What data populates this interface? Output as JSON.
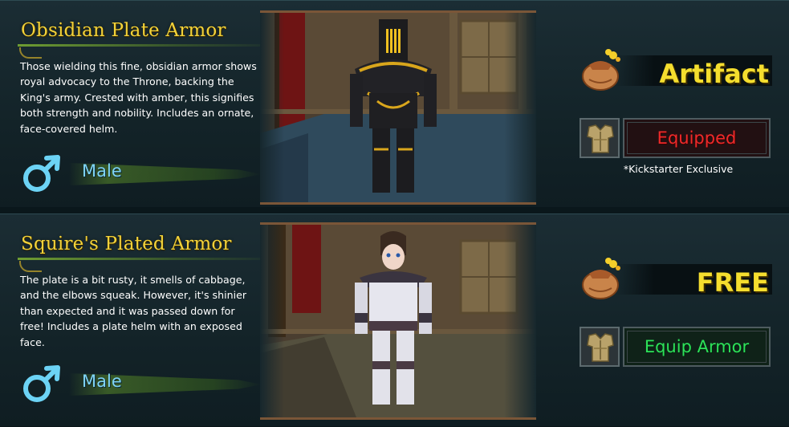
{
  "colors": {
    "title": "#f2d23a",
    "gender_label": "#7fd4f4",
    "price": "#f5de2e",
    "equipped": "#ee2a2a",
    "equip": "#2ee05a"
  },
  "items": [
    {
      "title": "Obsidian Plate Armor",
      "description": "Those wielding this fine, obsidian armor shows royal advocacy to the Throne, backing the King's army. Crested with amber, this signifies both strength and nobility. Includes an ornate, face-covered helm.",
      "gender": "Male",
      "gender_icon": "male-symbol-icon",
      "price": "Artifact",
      "price_icon": "coin-bag-icon",
      "action": "Equipped",
      "action_state": "equipped",
      "note": "*Kickstarter Exclusive"
    },
    {
      "title": "Squire's Plated Armor",
      "description": "The plate is a bit rusty, it smells of cabbage, and the elbows squeak. However, it's shinier than expected and it was passed down for free! Includes a plate helm with an exposed face.",
      "gender": "Male",
      "gender_icon": "male-symbol-icon",
      "price": "FREE",
      "price_icon": "coin-bag-icon",
      "action": "Equip Armor",
      "action_state": "available"
    }
  ]
}
